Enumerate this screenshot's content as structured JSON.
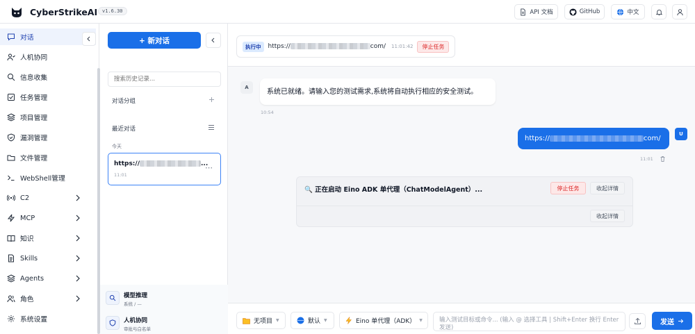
{
  "app": {
    "name": "CyberStrikeAI",
    "version": "v1.6.30"
  },
  "topbar": {
    "api_docs": "API 文档",
    "github": "GitHub",
    "language": "中文"
  },
  "sidebar": {
    "items": [
      {
        "label": "对话",
        "icon": "chat-icon",
        "active": true
      },
      {
        "label": "人机协同",
        "icon": "user-collab-icon"
      },
      {
        "label": "信息收集",
        "icon": "search-icon"
      },
      {
        "label": "任务管理",
        "icon": "task-icon"
      },
      {
        "label": "项目管理",
        "icon": "layers-icon"
      },
      {
        "label": "漏洞管理",
        "icon": "shield-icon"
      },
      {
        "label": "文件管理",
        "icon": "folder-icon"
      },
      {
        "label": "WebShell管理",
        "icon": "terminal-icon"
      },
      {
        "label": "C2",
        "icon": "broadcast-icon",
        "expandable": true
      },
      {
        "label": "MCP",
        "icon": "bolt-icon",
        "expandable": true
      },
      {
        "label": "知识",
        "icon": "book-icon",
        "expandable": true
      },
      {
        "label": "Skills",
        "icon": "document-icon",
        "expandable": true
      },
      {
        "label": "Agents",
        "icon": "layers-icon",
        "expandable": true
      },
      {
        "label": "角色",
        "icon": "users-icon",
        "expandable": true
      },
      {
        "label": "系统设置",
        "icon": "gear-icon"
      }
    ]
  },
  "history": {
    "new_chat": "+ 新对话",
    "search_placeholder": "搜索历史记录...",
    "groups_title": "对话分组",
    "recent_title": "最近对话",
    "today": "今天",
    "conversation": {
      "title_prefix": "https://",
      "time": "11:01"
    }
  },
  "panel_bottom": {
    "model": {
      "title": "模型推理",
      "subtitle": "系统 / —"
    },
    "collab": {
      "title": "人机协同",
      "subtitle": "审批与白名单"
    }
  },
  "task_status": {
    "badge": "执行中",
    "url_prefix": "https://",
    "url_suffix": "com/",
    "time": "11:01:42",
    "stop": "停止任务"
  },
  "messages": [
    {
      "role": "assistant",
      "avatar": "A",
      "text": "系统已就绪。请输入您的测试需求,系统将自动执行相应的安全测试。",
      "time": "10:54"
    },
    {
      "role": "user",
      "avatar": "U",
      "url_prefix": "https://",
      "url_suffix": "com/",
      "time": "11:01"
    }
  ],
  "process": {
    "title": "🔍 正在启动 Eino ADK 单代理（ChatModelAgent）...",
    "stop": "停止任务",
    "collapse": "收起详情",
    "collapse2": "收起详情"
  },
  "input": {
    "project": "无项目",
    "role": "默认",
    "agent": "Eino 单代理（ADK）",
    "placeholder": "输入测试目标或命令... (输入 @ 选择工具 | Shift+Enter 换行 Enter 发送)",
    "send": "发送"
  },
  "colors": {
    "accent": "#1a6fe8",
    "danger": "#dc2626",
    "active_bg": "#eef3fd"
  }
}
